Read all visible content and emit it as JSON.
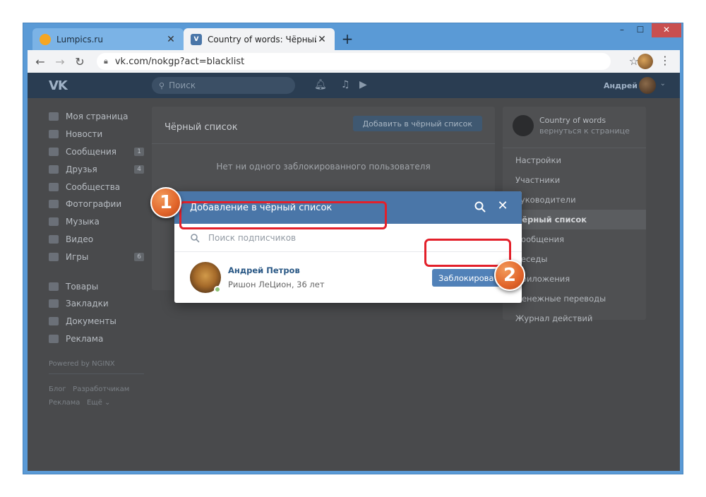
{
  "browser": {
    "tabs": [
      {
        "title": "Lumpics.ru",
        "favicon": "orange-circle-icon",
        "active": false
      },
      {
        "title": "Country of words: Чёрный списс",
        "favicon": "vk-icon",
        "active": true
      }
    ],
    "new_tab_symbol": "+",
    "url": "vk.com/nokgp?act=blacklist",
    "window_controls": {
      "minimize": "–",
      "maximize": "☐",
      "close": "✕"
    }
  },
  "vk": {
    "header": {
      "logo": "VK",
      "search_placeholder": "Поиск",
      "user_name": "Андрей"
    },
    "left_nav": {
      "items": [
        {
          "label": "Моя страница",
          "icon": "home-icon"
        },
        {
          "label": "Новости",
          "icon": "news-icon"
        },
        {
          "label": "Сообщения",
          "icon": "messages-icon",
          "count": "1"
        },
        {
          "label": "Друзья",
          "icon": "friends-icon",
          "count": "4"
        },
        {
          "label": "Сообщества",
          "icon": "groups-icon"
        },
        {
          "label": "Фотографии",
          "icon": "camera-icon"
        },
        {
          "label": "Музыка",
          "icon": "music-icon"
        },
        {
          "label": "Видео",
          "icon": "video-icon"
        },
        {
          "label": "Игры",
          "icon": "games-icon",
          "count": "6"
        }
      ],
      "secondary_items": [
        {
          "label": "Товары",
          "icon": "bag-icon"
        },
        {
          "label": "Закладки",
          "icon": "star-icon"
        },
        {
          "label": "Документы",
          "icon": "document-icon"
        },
        {
          "label": "Реклама",
          "icon": "megaphone-icon"
        }
      ],
      "powered_by": "Powered by NGINX",
      "footer_line1": "Блог   Разработчикам",
      "footer_line2": "Реклама   Ещё ⌄"
    },
    "main": {
      "title": "Чёрный список",
      "add_button": "Добавить в чёрный список",
      "empty_text": "Нет ни одного заблокированного пользователя"
    },
    "right_nav": {
      "group_name": "Country of words",
      "group_back": "вернуться к странице",
      "items": [
        {
          "label": "Настройки",
          "selected": false
        },
        {
          "label": "Участники",
          "selected": false
        },
        {
          "label": "Руководители",
          "selected": false
        },
        {
          "label": "Чёрный список",
          "selected": true
        },
        {
          "label": "Сообщения",
          "selected": false
        },
        {
          "label": "Беседы",
          "selected": false
        },
        {
          "label": "Приложения",
          "selected": false
        },
        {
          "label": "Денежные переводы",
          "selected": false
        },
        {
          "label": "Журнал действий",
          "selected": false
        }
      ]
    },
    "modal": {
      "title": "Добавление в чёрный список",
      "search_placeholder": "Поиск подписчиков",
      "user": {
        "name": "Андрей Петров",
        "info": "Ришон ЛеЦион, 36 лет",
        "online": true
      },
      "block_button": "Заблокировать"
    }
  },
  "annotations": {
    "badge1": "1",
    "badge2": "2",
    "highlight_color": "#e3202a",
    "badge_color": "#e1642a"
  },
  "colors": {
    "vk_blue": "#4a76a8",
    "button_blue": "#5181b8",
    "link_blue": "#2a5885",
    "chrome_frame": "#5a9ad6"
  }
}
